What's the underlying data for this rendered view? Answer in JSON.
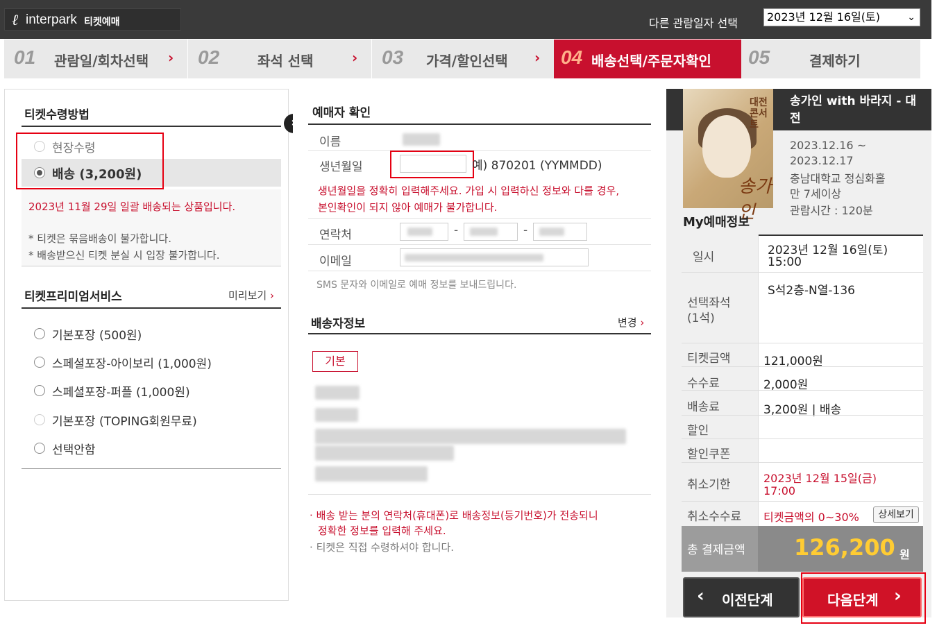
{
  "header": {
    "logo_mark": "ℓ",
    "logo_text": "interpark",
    "logo_sub": "티켓예매",
    "date_label": "다른 관람일자 선택",
    "date_selected": "2023년 12월 16일(토)",
    "date_chevron": "⌄"
  },
  "steps": [
    {
      "num": "01",
      "label": "관람일/회차선택",
      "arrow": "›"
    },
    {
      "num": "02",
      "label": "좌석 선택",
      "arrow": "›"
    },
    {
      "num": "03",
      "label": "가격/할인선택",
      "arrow": "›"
    },
    {
      "num": "04",
      "label": "배송선택/주문자확인",
      "arrow": "›"
    },
    {
      "num": "05",
      "label": "결제하기",
      "arrow": ""
    }
  ],
  "receive": {
    "title": "티켓수령방법",
    "options": [
      "현장수령",
      "배송 (3,200원)"
    ],
    "selected_index": 1,
    "note_red": "2023년 11월 29일 일괄 배송되는 상품입니다.",
    "notes": [
      "* 티켓은 묶음배송이 불가합니다.",
      "* 배송받으신 티켓 분실 시 입장 불가합니다."
    ]
  },
  "premium": {
    "title": "티켓프리미엄서비스",
    "preview_link": "미리보기",
    "options": [
      "기본포장 (500원)",
      "스페셜포장-아이보리 (1,000원)",
      "스페셜포장-퍼플 (1,000원)",
      "기본포장 (TOPING회원무료)",
      "선택안함"
    ]
  },
  "orderer": {
    "title": "예매자 확인",
    "name_label": "이름",
    "birth_label": "생년월일",
    "birth_value": "",
    "birth_example": "예) 870201 (YYMMDD)",
    "birth_warning_1": "생년월일을 정확히 입력해주세요. 가입 시 입력하신 정보와 다를 경우,",
    "birth_warning_2": "본인확인이 되지 않아 예매가 불가합니다.",
    "phone_label": "연락처",
    "phone_sep": "-",
    "email_label": "이메일",
    "sms_note": "SMS 문자와 이메일로 예매 정보를 보내드립니다."
  },
  "delivery": {
    "title": "배송자정보",
    "change_link": "변경",
    "tag": "기본",
    "notes": [
      "배송 받는 분의 연락처(휴대폰)로 배송정보(등기번호)가 전송되니",
      "정확한 정보를 입력해 주세요.",
      "티켓은 직접 수령하셔야 합니다."
    ],
    "bullet": "·"
  },
  "show": {
    "poster_text": "대전 콘서트",
    "poster_script": "송가인",
    "title": "송가인 with 바라지 - 대전",
    "dates_1": "2023.12.16 ~",
    "dates_2": "2023.12.17",
    "venue": "충남대학교 정심화홀",
    "age": "만 7세이상",
    "runtime": "관람시간 : 120분"
  },
  "my_booking": {
    "title": "My예매정보",
    "rows": {
      "date_label": "일시",
      "date_value_1": "2023년 12월 16일(토)",
      "date_value_2": "15:00",
      "seat_label_1": "선택좌석",
      "seat_label_2": "(1석)",
      "seat_value": "S석2층-N열-136",
      "price_label": "티켓금액",
      "price_value": "121,000원",
      "fee_label": "수수료",
      "fee_value": "2,000원",
      "ship_label": "배송료",
      "ship_value": "3,200원 | 배송",
      "discount_label": "할인",
      "coupon_label": "할인쿠폰",
      "cancel_deadline_label": "취소기한",
      "cancel_deadline_1": "2023년 12월 15일(금)",
      "cancel_deadline_2": "17:00",
      "cancel_fee_label": "취소수수료",
      "cancel_fee_value": "티켓금액의 0~30%",
      "detail_button": "상세보기"
    },
    "total_label": "총 결제금액",
    "total_value": "126,200",
    "total_unit": "원"
  },
  "buttons": {
    "prev": "이전단계",
    "next": "다음단계",
    "prev_icon": "‹",
    "next_icon": "›"
  },
  "colors": {
    "accent": "#c8102e",
    "total_amount": "#ffcc33",
    "header_bg": "#3a3a3a"
  }
}
